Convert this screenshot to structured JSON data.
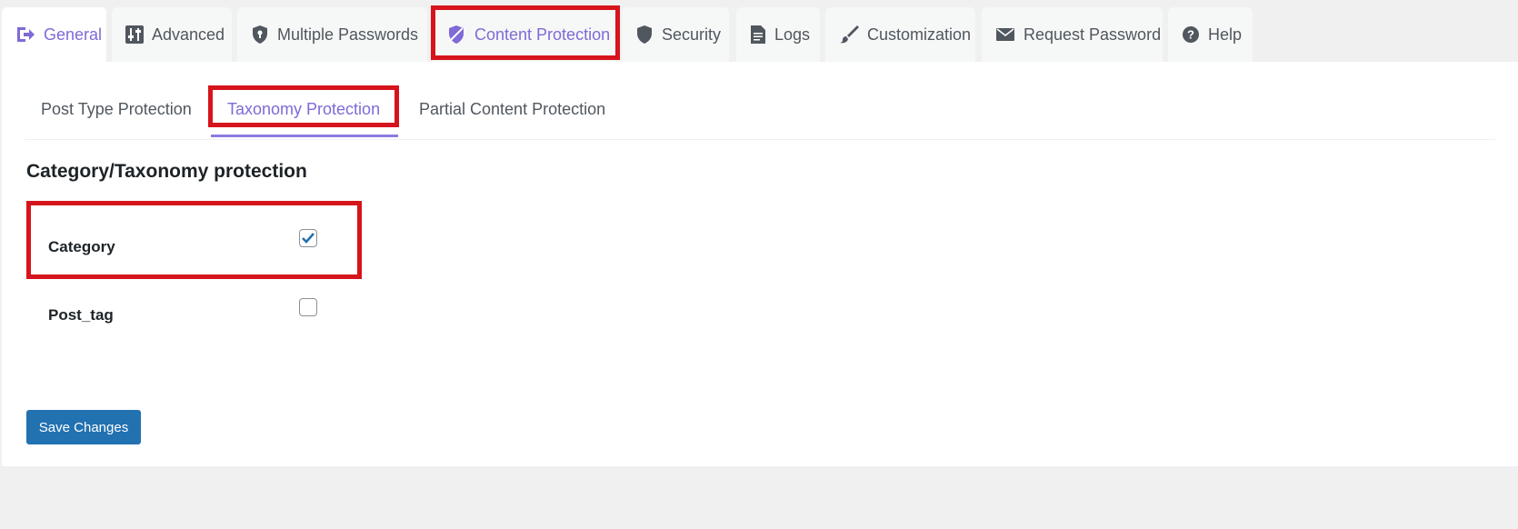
{
  "tabs": [
    {
      "label": "General",
      "icon": "login-icon"
    },
    {
      "label": "Advanced",
      "icon": "sliders-icon"
    },
    {
      "label": "Multiple Passwords",
      "icon": "shield-icon"
    },
    {
      "label": "Content Protection",
      "icon": "hidden-shield-icon"
    },
    {
      "label": "Security",
      "icon": "shield-icon"
    },
    {
      "label": "Logs",
      "icon": "document-icon"
    },
    {
      "label": "Customization",
      "icon": "brush-icon"
    },
    {
      "label": "Request Password",
      "icon": "email-icon"
    },
    {
      "label": "Help",
      "icon": "help-icon"
    }
  ],
  "subtabs": [
    {
      "label": "Post Type Protection"
    },
    {
      "label": "Taxonomy Protection"
    },
    {
      "label": "Partial Content Protection"
    }
  ],
  "section": {
    "title": "Category/Taxonomy protection"
  },
  "taxonomies": [
    {
      "label": "Category",
      "checked": true
    },
    {
      "label": "Post_tag",
      "checked": false
    }
  ],
  "save_button": {
    "label": "Save Changes"
  },
  "colors": {
    "accent": "#7f6ad7",
    "highlight": "#d6141c",
    "button": "#2271b1",
    "checkmark": "#2271b1"
  }
}
